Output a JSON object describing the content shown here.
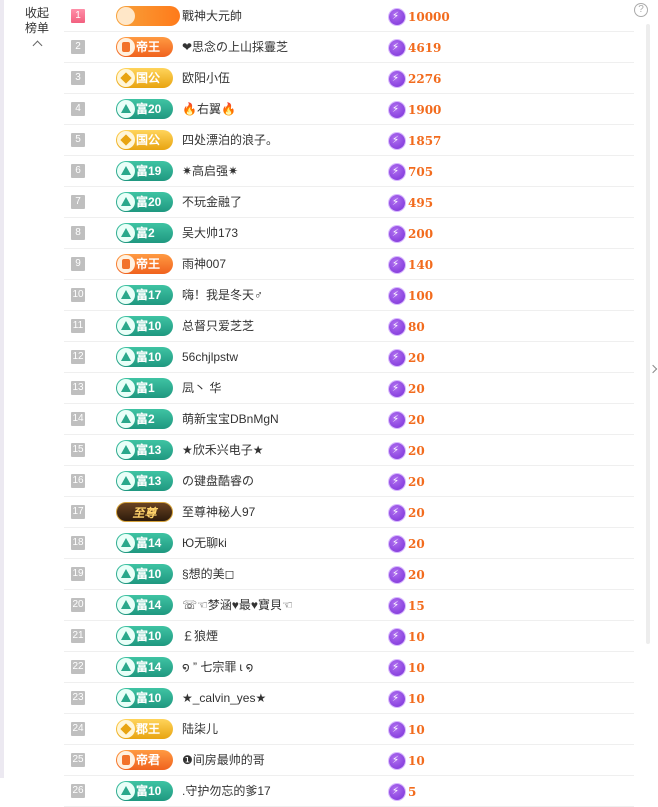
{
  "panel": {
    "collapse_label": "收起榜单",
    "help_label": "?"
  },
  "rows": [
    {
      "rank": "1",
      "badge": "",
      "tier": "plain",
      "name": "戰神大元帥",
      "value": "10000"
    },
    {
      "rank": "2",
      "badge": "帝王",
      "tier": "di",
      "name": "❤思念の上山採霻芝",
      "value": "4619"
    },
    {
      "rank": "3",
      "badge": "国公",
      "tier": "guo",
      "name": "欧阳小伍",
      "value": "2276"
    },
    {
      "rank": "4",
      "badge": "富20",
      "tier": "fu",
      "name": "🔥右翼🔥",
      "value": "1900"
    },
    {
      "rank": "5",
      "badge": "国公",
      "tier": "guo",
      "name": "四处漂泊的浪子。",
      "value": "1857"
    },
    {
      "rank": "6",
      "badge": "富19",
      "tier": "fu",
      "name": "✷高启强✷",
      "value": "705"
    },
    {
      "rank": "7",
      "badge": "富20",
      "tier": "fu",
      "name": "不玩金融了",
      "value": "495"
    },
    {
      "rank": "8",
      "badge": "富2",
      "tier": "fu",
      "name": "吴大帅173",
      "value": "200"
    },
    {
      "rank": "9",
      "badge": "帝王",
      "tier": "di",
      "name": "雨神007",
      "value": "140"
    },
    {
      "rank": "10",
      "badge": "富17",
      "tier": "fu",
      "name": "嗨！我是冬天♂",
      "value": "100"
    },
    {
      "rank": "11",
      "badge": "富10",
      "tier": "fu",
      "name": "总督只爱芝芝",
      "value": "80"
    },
    {
      "rank": "12",
      "badge": "富10",
      "tier": "fu",
      "name": "56chjlpstw",
      "value": "20"
    },
    {
      "rank": "13",
      "badge": "富1",
      "tier": "fu",
      "name": "凨丶 华",
      "value": "20"
    },
    {
      "rank": "14",
      "badge": "富2",
      "tier": "fu",
      "name": "萌新宝宝DBnMgN",
      "value": "20"
    },
    {
      "rank": "15",
      "badge": "富13",
      "tier": "fu",
      "name": "★欣禾兴电子★",
      "value": "20"
    },
    {
      "rank": "16",
      "badge": "富13",
      "tier": "fu",
      "name": "の键盘酷睿の",
      "value": "20"
    },
    {
      "rank": "17",
      "badge": "至尊",
      "tier": "zhi",
      "name": "至尊神秘人97",
      "value": "20"
    },
    {
      "rank": "18",
      "badge": "富14",
      "tier": "fu",
      "name": "Ю无聊ki",
      "value": "20"
    },
    {
      "rank": "19",
      "badge": "富10",
      "tier": "fu",
      "name": "§想的美◻",
      "value": "20"
    },
    {
      "rank": "20",
      "badge": "富14",
      "tier": "fu",
      "name": "☏☜梦涵♥最♥寶貝☜",
      "value": "15"
    },
    {
      "rank": "21",
      "badge": "富10",
      "tier": "fu",
      "name": "￡狼煙",
      "value": "10"
    },
    {
      "rank": "22",
      "badge": "富14",
      "tier": "fu",
      "name": "໑ ” 七宗罪 ɩ ໑",
      "value": "10"
    },
    {
      "rank": "23",
      "badge": "富10",
      "tier": "fu",
      "name": "★_calvin_yes★",
      "value": "10"
    },
    {
      "rank": "24",
      "badge": "郡王",
      "tier": "guo",
      "name": "陆柒儿",
      "value": "10"
    },
    {
      "rank": "25",
      "badge": "帝君",
      "tier": "di",
      "name": "❶间房最帅的哥",
      "value": "10"
    },
    {
      "rank": "26",
      "badge": "富10",
      "tier": "fu",
      "name": ".守护勿忘的爹17",
      "value": "5"
    }
  ]
}
